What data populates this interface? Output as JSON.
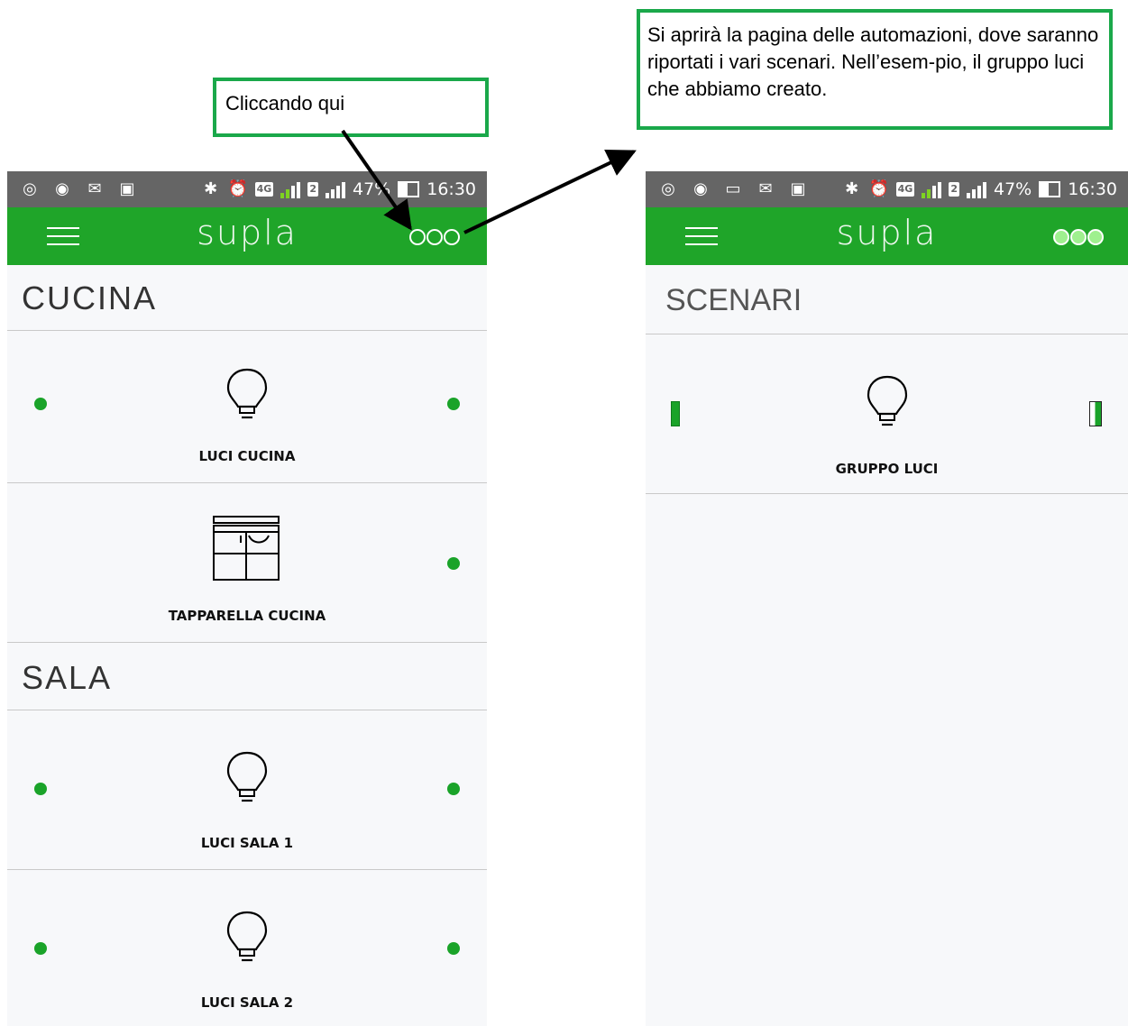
{
  "annotations": {
    "click_here": "Cliccando qui",
    "result_note": "Si aprirà la pagina delle automazioni, dove saranno riportati i vari scenari. Nell’esem-pio, il gruppo luci che abbiamo creato."
  },
  "status_bar": {
    "battery": "47%",
    "time": "16:30",
    "network": "4G",
    "sim2": "2"
  },
  "app": {
    "logo": "supla"
  },
  "left_screen": {
    "sections": [
      {
        "title": "CUCINA",
        "items": [
          {
            "label": "LUCI CUCINA",
            "icon": "lightbulb-icon"
          },
          {
            "label": "TAPPARELLA CUCINA",
            "icon": "window-shutter-icon"
          }
        ]
      },
      {
        "title": "SALA",
        "items": [
          {
            "label": "LUCI SALA 1",
            "icon": "lightbulb-icon"
          },
          {
            "label": "LUCI SALA 2",
            "icon": "lightbulb-icon"
          }
        ]
      }
    ]
  },
  "right_screen": {
    "section_title": "SCENARI",
    "items": [
      {
        "label": "GRUPPO LUCI",
        "icon": "lightbulb-icon"
      }
    ]
  },
  "colors": {
    "accent": "#1fa529",
    "status_bar": "#656565",
    "callout_border": "#1aa84a",
    "background": "#f7f8fa"
  }
}
